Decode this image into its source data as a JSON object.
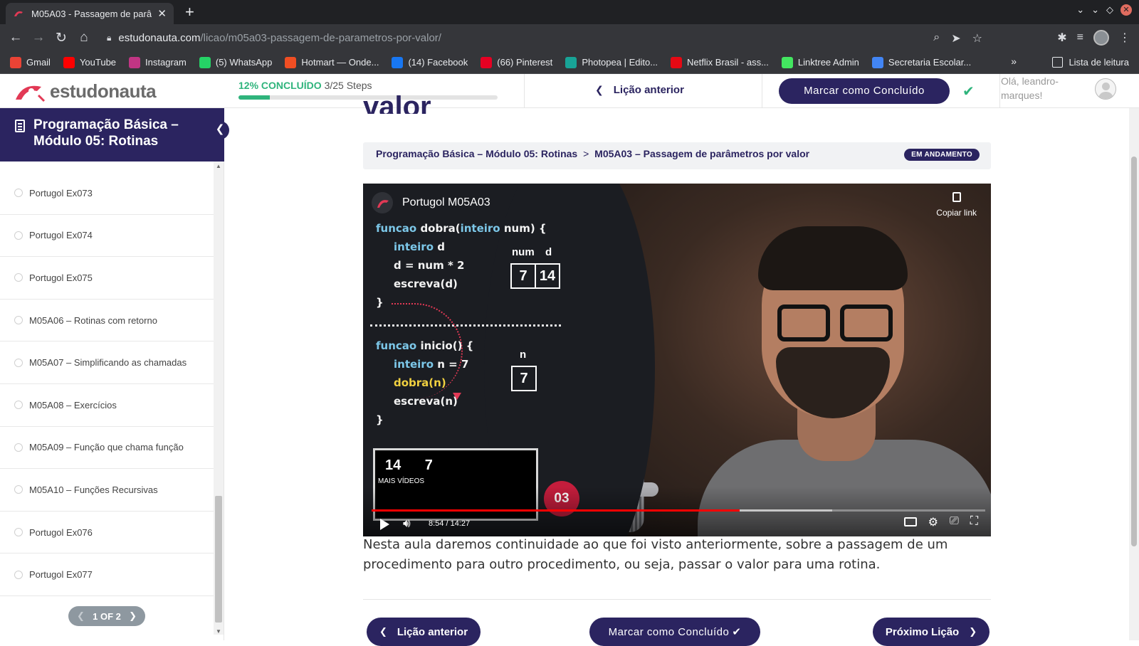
{
  "browser": {
    "tab_title": "M05A03 - Passagem de parâm",
    "url_host": "estudonauta.com",
    "url_path": "/licao/m05a03-passagem-de-parametros-por-valor/",
    "bookmarks": [
      {
        "label": "Gmail",
        "color": "#ea4335"
      },
      {
        "label": "YouTube",
        "color": "#ff0000"
      },
      {
        "label": "Instagram",
        "color": "#c13584"
      },
      {
        "label": "(5) WhatsApp",
        "color": "#25d366"
      },
      {
        "label": "Hotmart — Onde...",
        "color": "#f04e23"
      },
      {
        "label": "(14) Facebook",
        "color": "#1877f2"
      },
      {
        "label": "(66) Pinterest",
        "color": "#e60023"
      },
      {
        "label": "Photopea | Edito...",
        "color": "#18a497"
      },
      {
        "label": "Netflix Brasil - ass...",
        "color": "#e50914"
      },
      {
        "label": "Linktree Admin",
        "color": "#43e660"
      },
      {
        "label": "Secretaria Escolar...",
        "color": "#4285f4"
      }
    ],
    "reading_list": "Lista de leitura"
  },
  "header": {
    "logo_text": "estudonauta",
    "progress_pct_label": "12% CONCLUÍDO",
    "progress_steps": "3/25 Steps",
    "progress_fraction": 0.12,
    "prev_lesson": "Lição anterior",
    "mark_complete": "Marcar como Concluído",
    "greeting": "Olá, leandro-marques!"
  },
  "sidebar": {
    "course_title": "Programação Básica – Módulo 05: Rotinas",
    "lessons": [
      "Portugol Ex073",
      "Portugol Ex074",
      "Portugol Ex075",
      "M05A06 – Rotinas com retorno",
      "M05A07 – Simplificando as chamadas",
      "M05A08 – Exercícios",
      "M05A09 – Função que chama função",
      "M05A10 – Funções Recursivas",
      "Portugol Ex076",
      "Portugol Ex077"
    ],
    "pager": "1 OF 2"
  },
  "main": {
    "heading_fragment": "valor",
    "breadcrumb_course": "Programação Básica – Módulo 05: Rotinas",
    "breadcrumb_sep": ">",
    "breadcrumb_lesson": "M05A03 – Passagem de parâmetros por valor",
    "status": "EM ANDAMENTO",
    "description": "Nesta aula daremos continuidade ao que foi visto anteriormente, sobre a passagem de um procedimento para outro procedimento, ou seja, passar o valor para uma rotina.",
    "btn_prev": "Lição anterior",
    "btn_mark": "Marcar como Concluído",
    "btn_next": "Próximo Lição"
  },
  "video": {
    "title": "Portugol M05A03",
    "copy_link": "Copiar link",
    "code_a": {
      "kw1": "funcao",
      "fn1": "dobra(",
      "kw2": "inteiro",
      "rest1": "num) {",
      "kw3": "inteiro",
      "rest2": "d",
      "line3": "d = num * 2",
      "line4": "escreva(d)",
      "close": "}"
    },
    "code_b": {
      "kw1": "funcao",
      "rest1": "inicio() {",
      "kw2": "inteiro",
      "rest2": "n = 7",
      "fn1": "dobra(n)",
      "line3": "escreva(n)",
      "close": "}"
    },
    "label_num": "num",
    "label_d": "d",
    "val_num": "7",
    "val_d": "14",
    "label_n": "n",
    "val_n": "7",
    "more_nums": "14 7",
    "more_label": "MAIS VÍDEOS",
    "num03": "03",
    "time": "8:54 / 14:27",
    "played_fraction": 0.6,
    "buffered_fraction": 0.75
  }
}
